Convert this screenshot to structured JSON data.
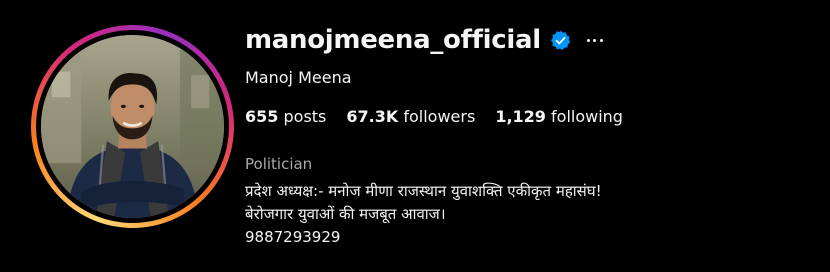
{
  "profile": {
    "username": "manojmeena_official",
    "full_name": "Manoj Meena",
    "category": "Politician",
    "verified": true,
    "bio_lines": [
      "प्रदेश अध्यक्ष:- मनोज मीणा राजस्थान युवाशक्ति एकीकृत महासंघ!",
      "बेरोजगार युवाओं की मजबूत आवाज।",
      "9887293929"
    ]
  },
  "stats": {
    "posts_count": "655",
    "posts_label": "posts",
    "followers_count": "67.3K",
    "followers_label": "followers",
    "following_count": "1,129",
    "following_label": "following"
  },
  "icons": {
    "verified": "verified-badge-icon",
    "more": "more-options-icon"
  },
  "colors": {
    "background": "#000000",
    "text": "#f5f5f5",
    "secondary_text": "#a8a8a8",
    "verified_blue": "#0095f6"
  }
}
